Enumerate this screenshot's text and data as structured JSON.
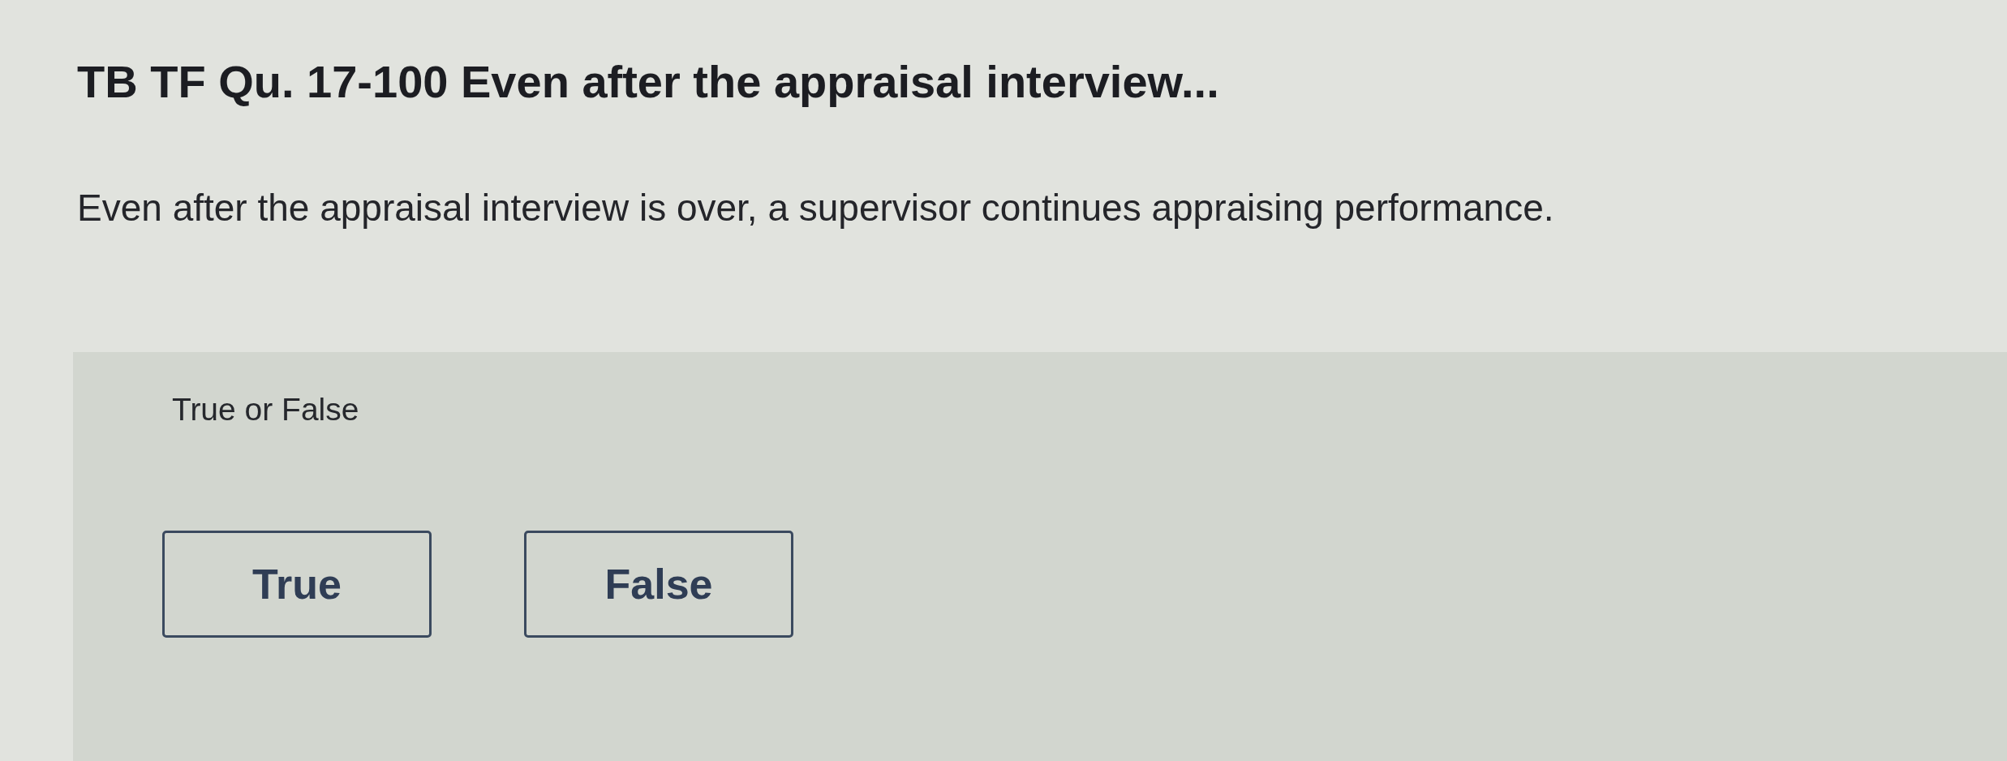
{
  "question": {
    "title": "TB TF Qu. 17-100 Even after the appraisal interview...",
    "text": "Even after the appraisal interview is over, a supervisor continues appraising performance."
  },
  "answer_panel": {
    "prompt": "True or False",
    "options": [
      {
        "label": "True",
        "selected": false
      },
      {
        "label": "False",
        "selected": false
      }
    ]
  }
}
